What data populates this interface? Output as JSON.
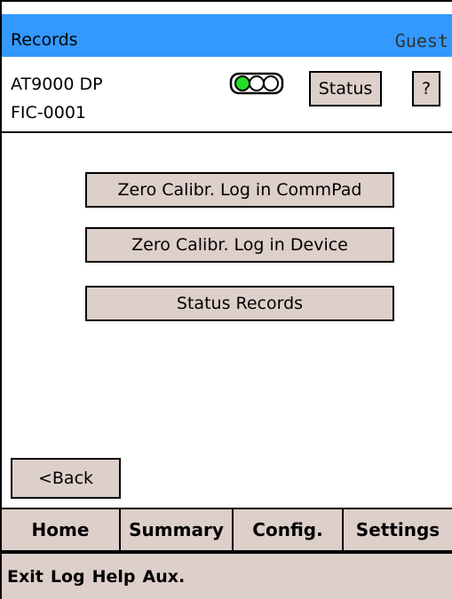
{
  "titlebar": {
    "title": "Records",
    "user": "Guest",
    "color": "#3399ff"
  },
  "device": {
    "model": "AT9000 DP",
    "tag": "FIC-0001"
  },
  "indicator": {
    "icon": "traffic-light-icon",
    "lit": "green"
  },
  "header_buttons": {
    "status_label": "Status",
    "help_label": "?"
  },
  "main": {
    "buttons": [
      {
        "label": "Zero Calibr. Log in CommPad"
      },
      {
        "label": "Zero Calibr. Log in Device"
      },
      {
        "label": "Status Records"
      }
    ],
    "back_label": "<Back"
  },
  "tabs": [
    {
      "label": "Home"
    },
    {
      "label": "Summary"
    },
    {
      "label": "Config."
    },
    {
      "label": "Settings"
    }
  ],
  "menubar": [
    {
      "label": "Exit"
    },
    {
      "label": "Log"
    },
    {
      "label": "Help"
    },
    {
      "label": "Aux."
    }
  ],
  "colors": {
    "button_bg": "#ddcfc9",
    "accent": "#3399ff",
    "indicator_on": "#22dd22"
  }
}
